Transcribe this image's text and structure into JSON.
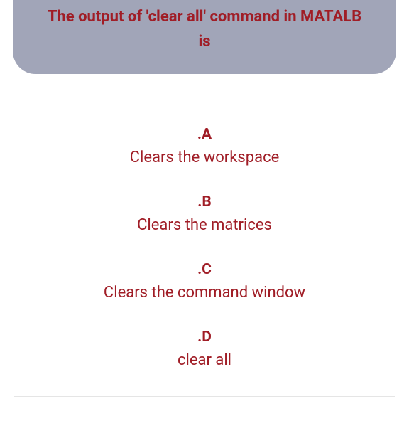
{
  "question": {
    "text": "The output of 'clear all' command in MATALB is"
  },
  "options": [
    {
      "label": ".A",
      "text": "Clears the workspace"
    },
    {
      "label": ".B",
      "text": "Clears the matrices"
    },
    {
      "label": ".C",
      "text": "Clears the command window"
    },
    {
      "label": ".D",
      "text": "clear all"
    }
  ]
}
